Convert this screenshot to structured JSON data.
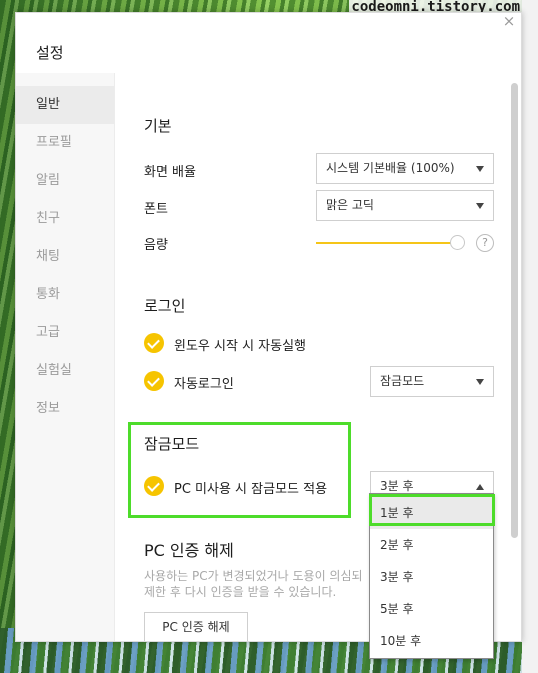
{
  "watermark": "codeomni.tistory.com",
  "dialog": {
    "title": "설정",
    "close_label": "×"
  },
  "sidebar": {
    "items": [
      {
        "label": "일반",
        "active": true
      },
      {
        "label": "프로필"
      },
      {
        "label": "알림"
      },
      {
        "label": "친구"
      },
      {
        "label": "채팅"
      },
      {
        "label": "통화"
      },
      {
        "label": "고급"
      },
      {
        "label": "실험실"
      },
      {
        "label": "정보"
      }
    ]
  },
  "general": {
    "title": "기본",
    "zoom": {
      "label": "화면 배율",
      "value": "시스템 기본배율 (100%)"
    },
    "font": {
      "label": "폰트",
      "value": "맑은 고딕"
    },
    "volume": {
      "label": "음량",
      "level": 1.0,
      "help": "?"
    }
  },
  "login": {
    "title": "로그인",
    "autostart": {
      "label": "윈도우 시작 시 자동실행",
      "checked": true
    },
    "autologin": {
      "label": "자동로그인",
      "checked": true,
      "mode": "잠금모드"
    }
  },
  "lockmode": {
    "title": "잠금모드",
    "idle_lock": {
      "label": "PC 미사용 시 잠금모드 적용",
      "checked": true,
      "value": "3분 후"
    },
    "options": [
      "1분 후",
      "2분 후",
      "3분 후",
      "5분 후",
      "10분 후"
    ],
    "highlighted_option": "1분 후"
  },
  "pc_auth": {
    "title": "PC 인증 해제",
    "desc_line1": "사용하는 PC가 변경되었거나 도용이 의심되",
    "desc_line2": "제한 후 다시 인증을 받을 수 있습니다.",
    "button": "PC 인증 해제"
  },
  "colors": {
    "accent": "#f6c400",
    "highlight": "#4ddc2a"
  }
}
